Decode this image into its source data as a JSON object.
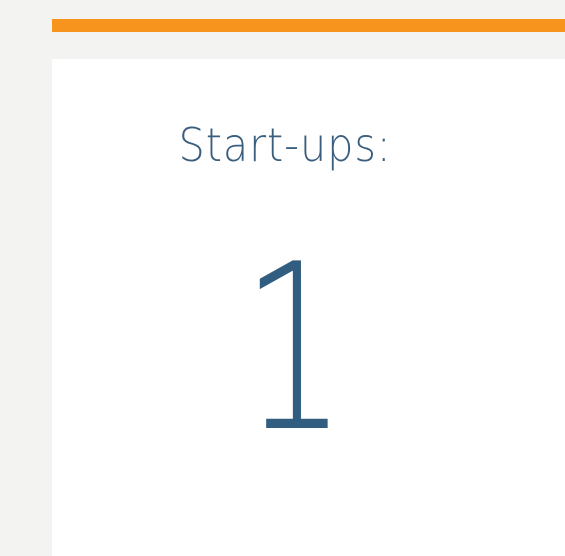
{
  "stat_card": {
    "label": "Start-ups:",
    "value": "1"
  },
  "colors": {
    "accent": "#f7941d",
    "text": "#305d80",
    "background": "#f3f3f2",
    "card": "#ffffff"
  }
}
